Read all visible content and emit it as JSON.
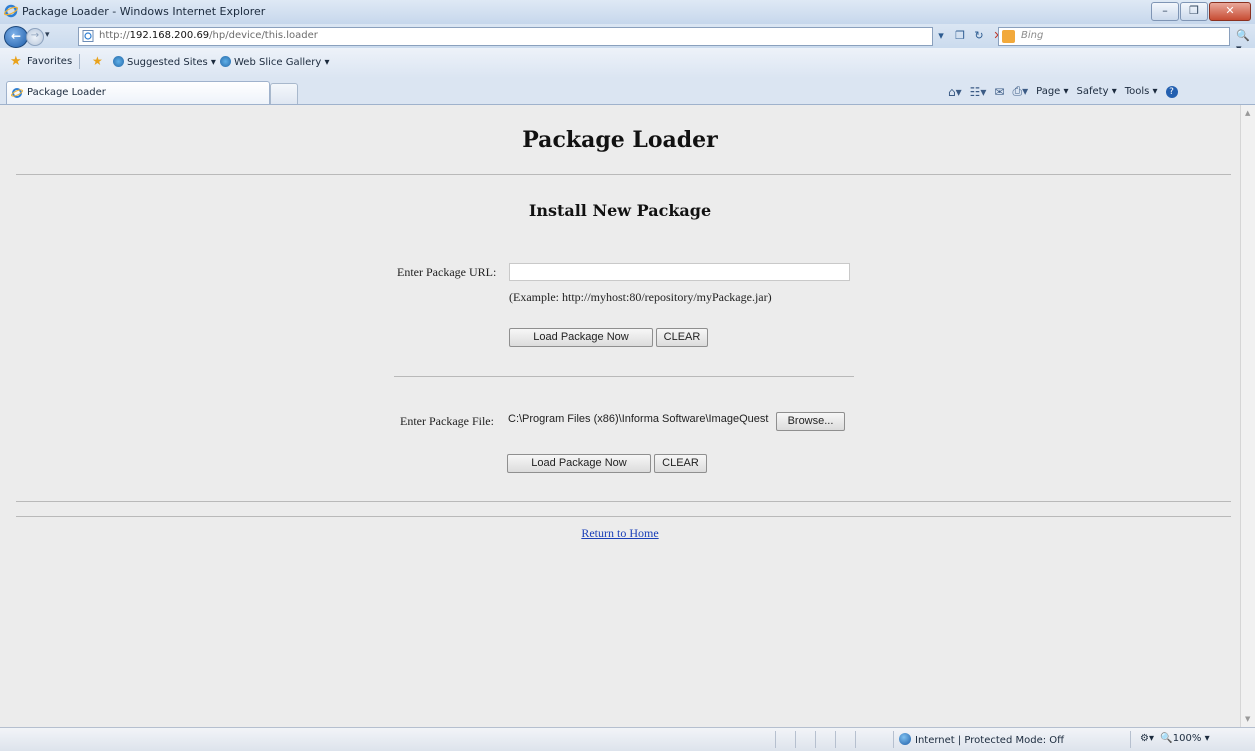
{
  "window": {
    "title": "Package Loader - Windows Internet Explorer"
  },
  "address_bar": {
    "url_prefix": "http://",
    "url_host": "192.168.200.69",
    "url_path": "/hp/device/this.loader",
    "search_placeholder": "Bing"
  },
  "favorites_bar": {
    "favorites_label": "Favorites",
    "items": [
      {
        "label": "Suggested Sites ▾"
      },
      {
        "label": "Web Slice Gallery ▾"
      }
    ]
  },
  "tabs": [
    {
      "label": "Package Loader"
    }
  ],
  "command_bar": {
    "page_label": "Page ▾",
    "safety_label": "Safety ▾",
    "tools_label": "Tools ▾"
  },
  "page": {
    "title": "Package Loader",
    "section_title": "Install New Package",
    "url_label": "Enter Package URL:",
    "url_value": "",
    "example_text": "(Example: http://myhost:80/repository/myPackage.jar)",
    "load_button_1": "Load Package Now",
    "clear_button_1": "CLEAR",
    "file_label": "Enter Package File:",
    "file_value": "C:\\Program Files (x86)\\Informa Software\\ImageQuest",
    "browse_button": "Browse...",
    "load_button_2": "Load Package Now",
    "clear_button_2": "CLEAR",
    "return_link": "Return to Home"
  },
  "status_bar": {
    "zone_text": "Internet | Protected Mode: Off",
    "zoom_text": "100%"
  },
  "colors": {
    "page_bg": "#ececec",
    "link": "#1a3fb8",
    "chrome": "#dbe5f2"
  }
}
